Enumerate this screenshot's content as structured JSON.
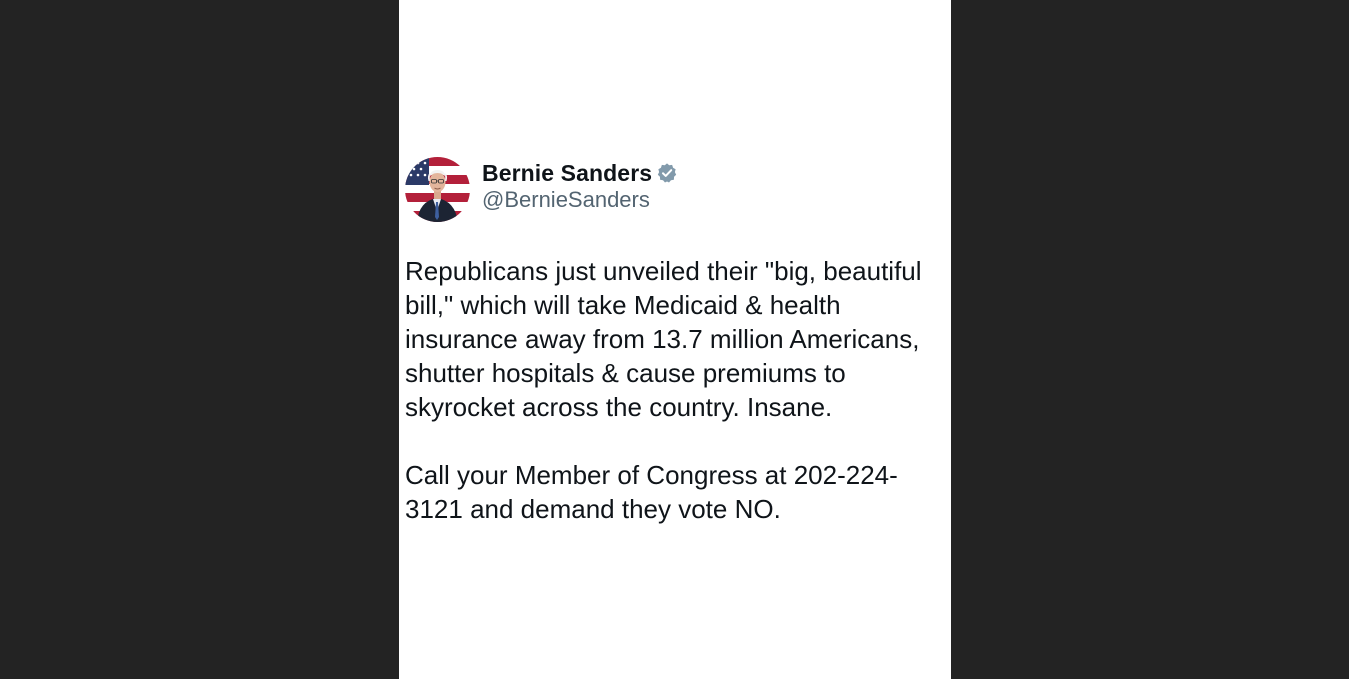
{
  "tweet": {
    "author": {
      "display_name": "Bernie Sanders",
      "handle": "@BernieSanders",
      "verified": true,
      "verified_color": "#829aab"
    },
    "paragraphs": [
      "Republicans just unveiled their \"big, beautiful bill,\" which will take Medicaid & health insurance away from 13.7 million Americans, shutter hospitals & cause premiums to skyrocket across the country. Insane.",
      "Call your Member of Congress at 202-224-3121 and demand they vote NO."
    ]
  },
  "colors": {
    "backdrop": "#232323",
    "card": "#ffffff",
    "text_primary": "#0f1419",
    "text_secondary": "#536471"
  },
  "icons": {
    "avatar": "profile-photo-icon",
    "badge": "verified-badge-icon"
  }
}
